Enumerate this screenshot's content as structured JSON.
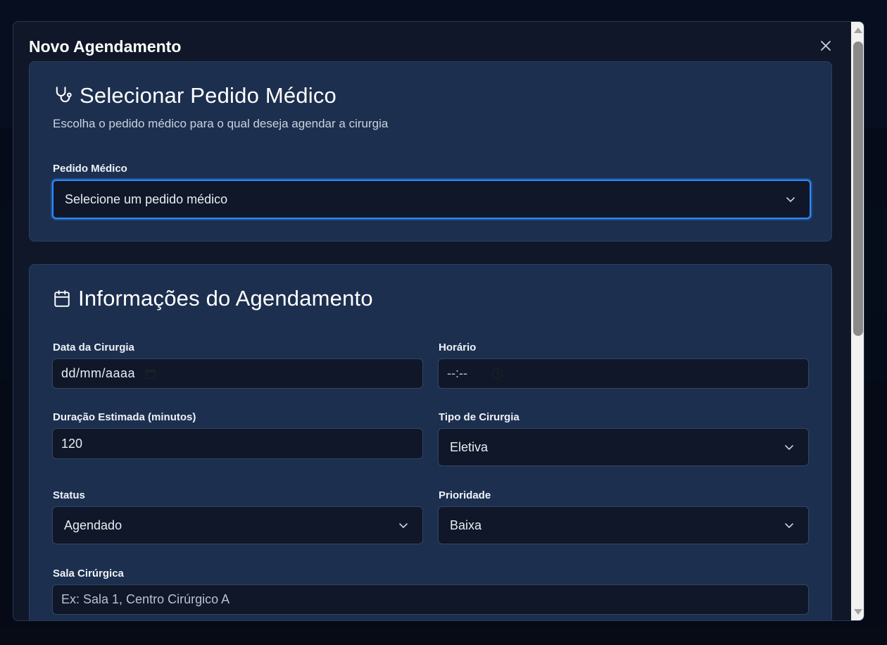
{
  "modal": {
    "title": "Novo Agendamento"
  },
  "order_section": {
    "heading": "Selecionar Pedido Médico",
    "description": "Escolha o pedido médico para o qual deseja agendar a cirurgia",
    "field_label": "Pedido Médico",
    "select_value": "Selecione um pedido médico"
  },
  "schedule_section": {
    "heading": "Informações do Agendamento",
    "date_label": "Data da Cirurgia",
    "date_placeholder": "dd/mm/aaaa",
    "time_label": "Horário",
    "time_placeholder": "--:--",
    "duration_label": "Duração Estimada (minutos)",
    "duration_value": "120",
    "type_label": "Tipo de Cirurgia",
    "type_value": "Eletiva",
    "status_label": "Status",
    "status_value": "Agendado",
    "priority_label": "Prioridade",
    "priority_value": "Baixa",
    "room_label": "Sala Cirúrgica",
    "room_placeholder": "Ex: Sala 1, Centro Cirúrgico A"
  },
  "icons": {
    "close": "close-icon",
    "stethoscope": "stethoscope-icon",
    "calendar": "calendar-icon",
    "chevron": "chevron-down-icon",
    "clock": "clock-icon"
  },
  "colors": {
    "modal_bg": "#0f1728",
    "card_bg": "#1c2f4e",
    "input_bg": "#0f1728",
    "focus_ring": "#2b8cff"
  }
}
